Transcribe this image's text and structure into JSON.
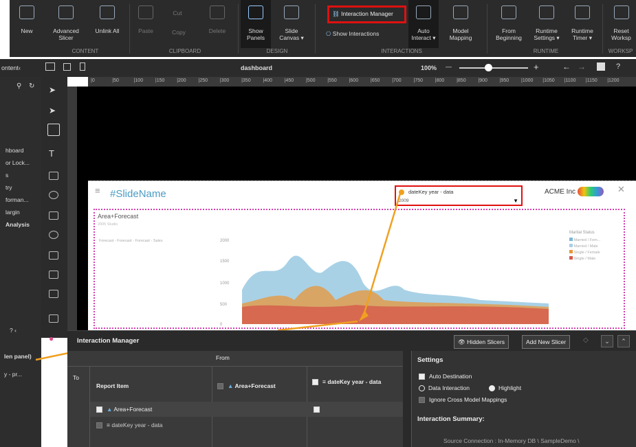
{
  "ribbon": {
    "new": "New",
    "advanced_slicer": "Advanced Slicer",
    "unlink_all": "Unlink All",
    "paste": "Paste",
    "cut": "Cut",
    "copy": "Copy",
    "delete": "Delete",
    "show_panels": "Show Panels",
    "slide_canvas": "Slide Canvas ▾",
    "interaction_manager": "Interaction Manager",
    "show_interactions": "Show Interactions",
    "auto_interact": "Auto Interact ▾",
    "model_mapping": "Model Mapping",
    "from_beginning": "From Beginning",
    "runtime_settings": "Runtime Settings ▾",
    "runtime_timer": "Runtime Timer ▾",
    "reset": "Reset Worksp",
    "groups": {
      "content": "CONTENT",
      "clipboard": "CLIPBOARD",
      "design": "DESIGN",
      "interactions": "INTERACTIONS",
      "runtime": "RUNTIME",
      "workspace": "WORKSP"
    }
  },
  "toolbar2": {
    "content": "ontent‹",
    "title": "dashboard",
    "zoom": "100%",
    "minus": "—",
    "plus": "+"
  },
  "left_panel": {
    "items": [
      "hboard",
      "or Lock...",
      "s",
      "try",
      "forman...",
      "largin",
      "Analysis"
    ],
    "bottom": [
      "? ‹",
      "len panel)",
      "y - pr..."
    ]
  },
  "ruler_ticks": [
    "|0",
    "|50",
    "|100",
    "|150",
    "|200",
    "|250",
    "|300",
    "|350",
    "|400",
    "|450",
    "|500",
    "|550",
    "|600",
    "|650",
    "|700",
    "|750",
    "|800",
    "|850",
    "|900",
    "|950",
    "|1000",
    "|1050",
    "|1100",
    "|1150",
    "|1200"
  ],
  "slide": {
    "name": "#SlideName",
    "slicer_title": "dateKey year - data",
    "slicer_value": "2009",
    "brand": "ACME Inc",
    "panel_title": "Area+Forecast",
    "panel_sub": "2005 Studio",
    "forecast_label": "Forecast - Forecast - Forecast - Sales",
    "y_ticks": [
      "2000",
      "1500",
      "1000",
      "500",
      "0"
    ],
    "legend_title": "Marital Status",
    "legend": [
      {
        "label": "Married / Fem...",
        "color": "#7ab8d8"
      },
      {
        "label": "Married / Male",
        "color": "#a8d0e6"
      },
      {
        "label": "Single / Female",
        "color": "#e8963a"
      },
      {
        "label": "Single / Male",
        "color": "#d65a4a"
      }
    ]
  },
  "interaction_manager": {
    "title": "Interaction Manager",
    "hidden_slicers": "Hidden Slicers",
    "add_new_slicer": "Add New Slicer",
    "from": "From",
    "to": "To",
    "report_item": "Report Item",
    "col1": "Area+Forecast",
    "col2": "dateKey year - data",
    "row1": "Area+Forecast",
    "row2": "dateKey year - data",
    "settings": "Settings",
    "auto_destination": "Auto Destination",
    "data_interaction": "Data Interaction",
    "highlight": "Highlight",
    "ignore_cross": "Ignore Cross Model Mappings",
    "summary": "Interaction Summary:",
    "source": "Source Connection : In-Memory DB \\ SampleDemo \\"
  }
}
